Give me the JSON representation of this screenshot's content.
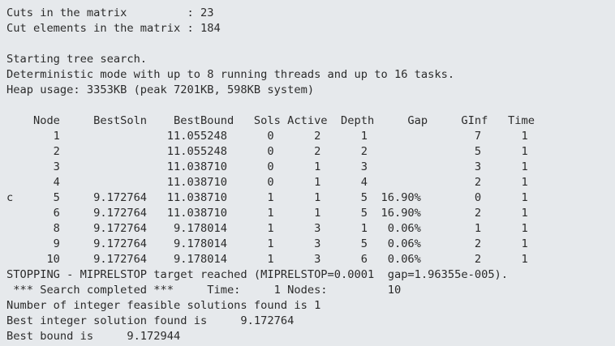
{
  "console": {
    "lines": [
      "Cuts in the matrix         : 23",
      "Cut elements in the matrix : 184",
      "",
      "Starting tree search.",
      "Deterministic mode with up to 8 running threads and up to 16 tasks.",
      "Heap usage: 3353KB (peak 7201KB, 598KB system)",
      "",
      "    Node     BestSoln    BestBound   Sols Active  Depth     Gap     GInf   Time",
      "       1                11.055248      0      2      1                7      1",
      "       2                11.055248      0      2      2                5      1",
      "       3                11.038710      0      1      3                3      1",
      "       4                11.038710      0      1      4                2      1",
      "c      5     9.172764   11.038710      1      1      5  16.90%        0      1",
      "       6     9.172764   11.038710      1      1      5  16.90%        2      1",
      "       8     9.172764    9.178014      1      3      1   0.06%        1      1",
      "       9     9.172764    9.178014      1      3      5   0.06%        2      1",
      "      10     9.172764    9.178014      1      3      6   0.06%        2      1",
      "STOPPING - MIPRELSTOP target reached (MIPRELSTOP=0.0001  gap=1.96355e-005).",
      " *** Search completed ***     Time:     1 Nodes:         10",
      "Number of integer feasible solutions found is 1",
      "Best integer solution found is     9.172764",
      "Best bound is     9.172944"
    ]
  }
}
